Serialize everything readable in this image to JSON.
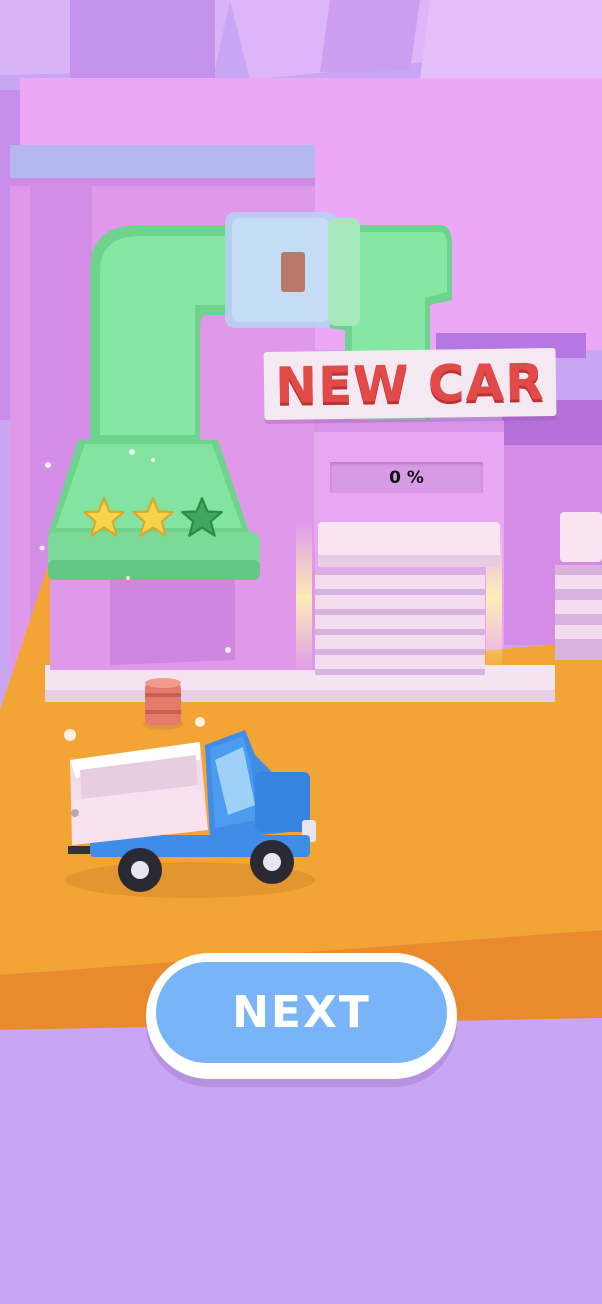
{
  "sign": {
    "text": "NEW CAR"
  },
  "progress": {
    "label": "0 %",
    "value": 0
  },
  "stars": {
    "earned": 2,
    "total": 3
  },
  "next_button": {
    "label": "NEXT"
  },
  "colors": {
    "sky": "#c9a6f3",
    "ground": "#f2a535",
    "building": "#e2a0ef",
    "pipe": "#7fe3a0",
    "truck": "#3f8de6",
    "button": "#79b3f8",
    "sign_text": "#e24a4a"
  }
}
